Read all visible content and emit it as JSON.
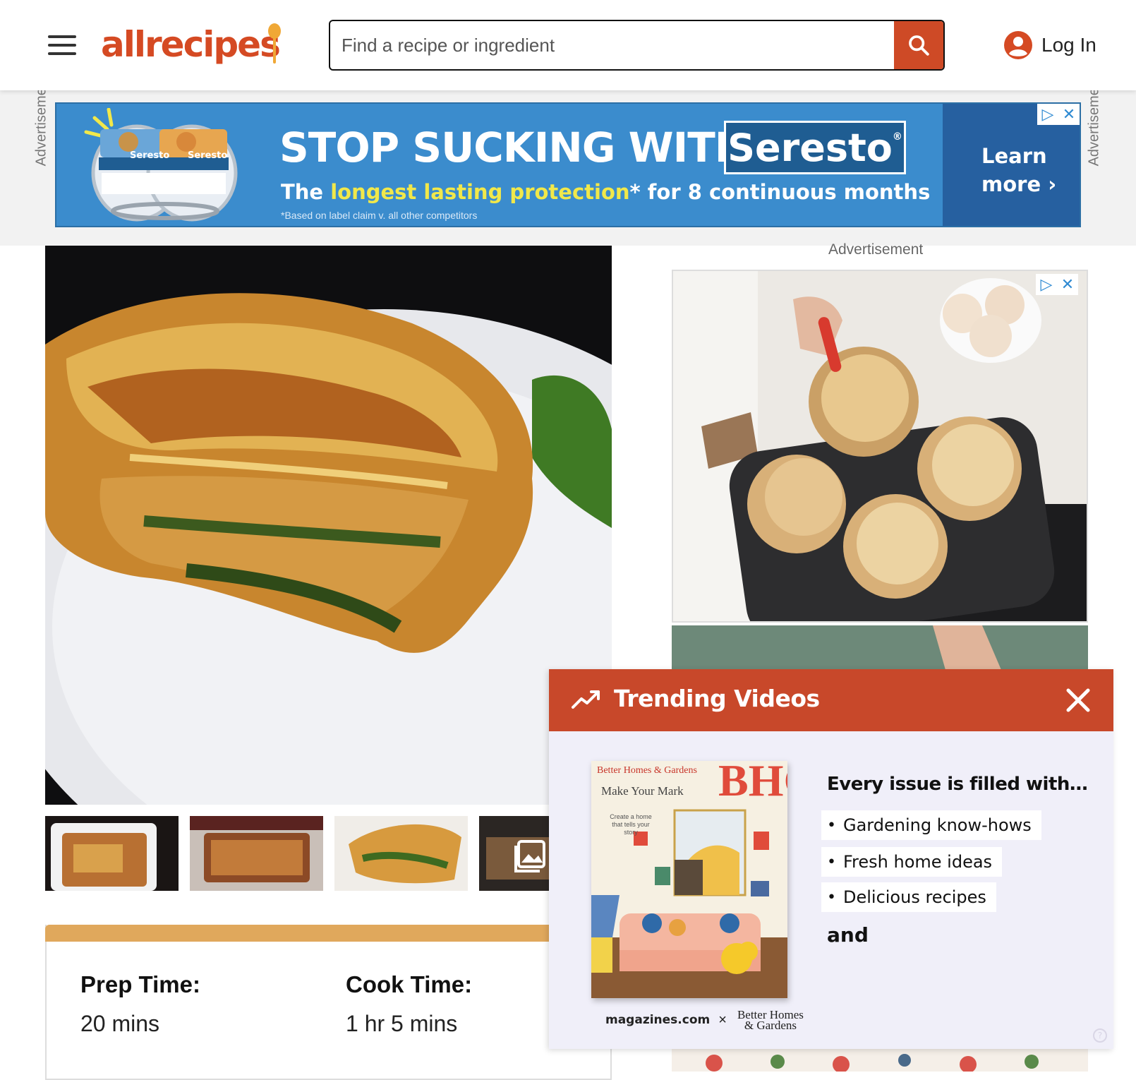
{
  "header": {
    "logo_text": "allrecipes",
    "search_placeholder": "Find a recipe or ingredient",
    "login_label": "Log In",
    "brand_color": "#d54a23"
  },
  "top_ad": {
    "side_label": "Advertisement",
    "headline": "STOP SUCKING WITH",
    "brand": "Seresto",
    "sub_prefix": "The ",
    "sub_highlight": "longest lasting protection",
    "sub_suffix": "* for 8 continuous months",
    "fine_print": "*Based on label claim v. all other competitors",
    "cta_line1": "Learn",
    "cta_line2": "more ›",
    "collar_labels": [
      "Seresto",
      "Seresto"
    ]
  },
  "recipe": {
    "prep_label": "Prep Time:",
    "prep_value": "20 mins",
    "cook_label": "Cook Time:",
    "cook_value": "1 hr 5 mins"
  },
  "side_ad": {
    "label": "Advertisement"
  },
  "trending": {
    "title": "Trending Videos",
    "magazine_brand": "Better Homes & Gardens",
    "magazine_big": "BHG",
    "magazine_tagline": "Make Your Mark",
    "magazine_small": "Create a home that tells your story",
    "heading": "Every issue is filled with…",
    "bullets": [
      "Gardening know-hows",
      "Fresh home ideas",
      "Delicious recipes"
    ],
    "and_text": "and",
    "logo_left": "magazines.com",
    "logo_x": "×",
    "logo_right": "Better Homes & Gardens"
  }
}
